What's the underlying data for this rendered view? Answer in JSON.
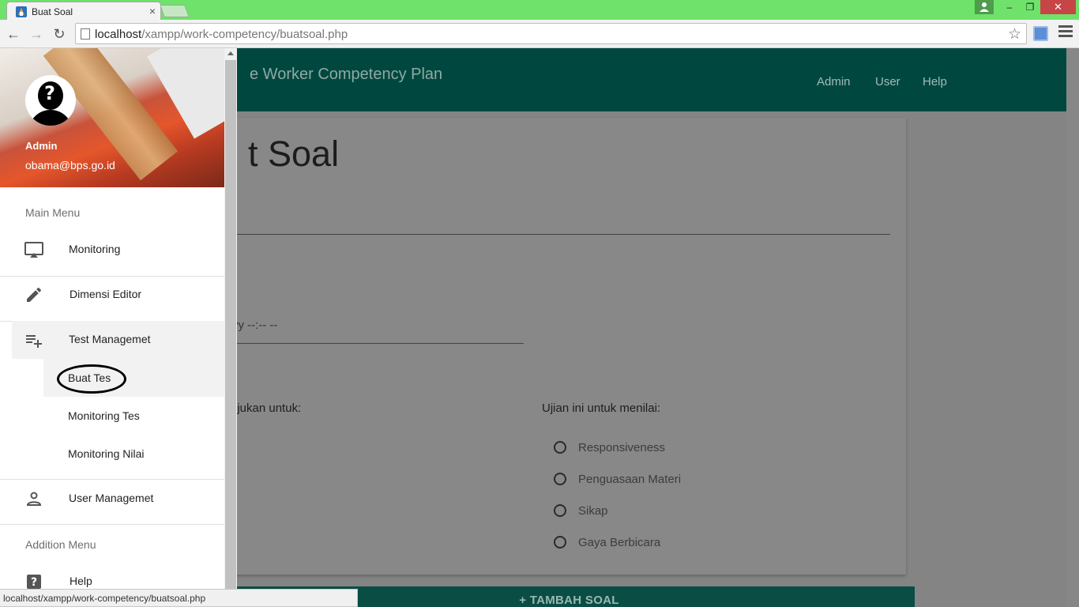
{
  "browser": {
    "tab_title": "Buat Soal",
    "tab_close": "×",
    "url_host": "localhost",
    "url_path": "/xampp/work-competency/buatsoal.php",
    "status_url": "localhost/xampp/work-competency/buatsoal.php",
    "window_controls": {
      "minimize": "–",
      "restore": "❐",
      "close": "✕"
    },
    "nav": {
      "back": "←",
      "forward": "→",
      "reload": "↻",
      "star": "☆"
    },
    "titlebar_color": "#6ee26b"
  },
  "appbar": {
    "title": "e Worker Competency Plan",
    "nav": [
      "Admin",
      "User",
      "Help"
    ],
    "color": "#00483f"
  },
  "page": {
    "heading": "t Soal",
    "datetime_placeholder": "yy --:-- --",
    "left_label": "ujukan untuk:",
    "right_label": "Ujian ini untuk menilai:",
    "criteria": [
      "Responsiveness",
      "Penguasaan Materi",
      "Sikap",
      "Gaya Berbicara"
    ],
    "add_button": "+ TAMBAH SOAL",
    "add_button_color": "#0a4d44"
  },
  "drawer": {
    "profile": {
      "name": "Admin",
      "email": "obama@bps.go.id"
    },
    "main_menu_header": "Main Menu",
    "items": {
      "monitoring": {
        "label": "Monitoring",
        "icon": "airplay-icon"
      },
      "dimensi_editor": {
        "label": "Dimensi Editor",
        "icon": "pencil-icon"
      },
      "test_managemet": {
        "label": "Test Managemet",
        "icon": "playlist-add-icon"
      },
      "user_managemet": {
        "label": "User Managemet",
        "icon": "person-icon"
      },
      "help": {
        "label": "Help",
        "icon": "help-icon"
      }
    },
    "test_sub_items": [
      "Buat Tes",
      "Monitoring Tes",
      "Monitoring Nilai"
    ],
    "addition_menu_header": "Addition Menu"
  }
}
